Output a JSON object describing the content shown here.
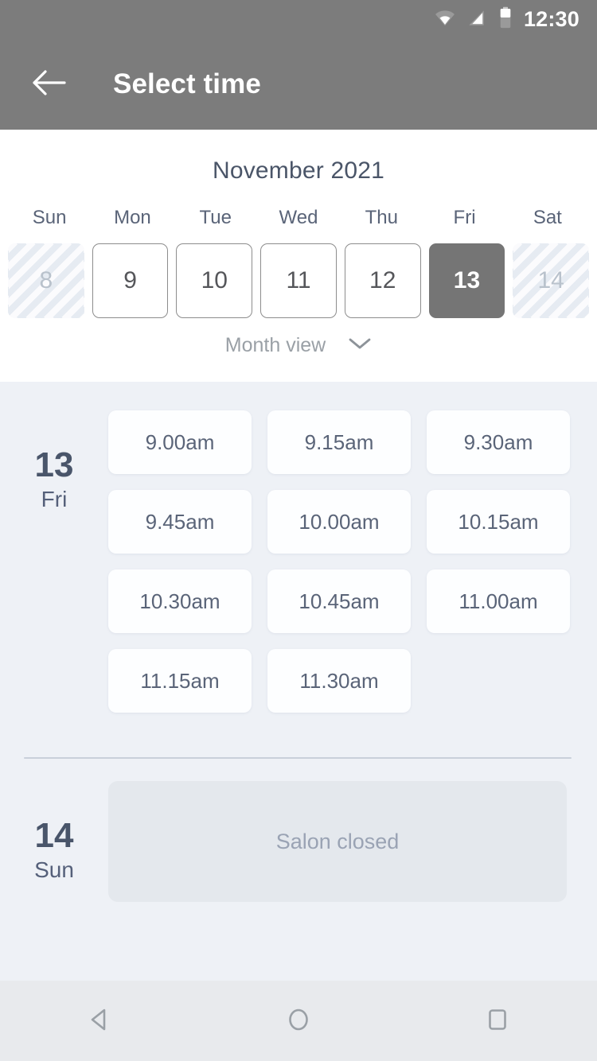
{
  "status_bar": {
    "time": "12:30",
    "icons": [
      "wifi-icon",
      "cellular-signal-icon",
      "battery-icon"
    ]
  },
  "app_bar": {
    "back_icon": "arrow-left-icon",
    "title": "Select time"
  },
  "calendar": {
    "month_title": "November 2021",
    "weekdays": [
      "Sun",
      "Mon",
      "Tue",
      "Wed",
      "Thu",
      "Fri",
      "Sat"
    ],
    "dates": [
      {
        "day": "8",
        "state": "disabled"
      },
      {
        "day": "9",
        "state": "enabled"
      },
      {
        "day": "10",
        "state": "enabled"
      },
      {
        "day": "11",
        "state": "enabled"
      },
      {
        "day": "12",
        "state": "enabled"
      },
      {
        "day": "13",
        "state": "selected"
      },
      {
        "day": "14",
        "state": "disabled"
      }
    ],
    "view_toggle": {
      "label": "Month view",
      "icon": "chevron-down-icon"
    }
  },
  "schedule": {
    "days": [
      {
        "day_number": "13",
        "day_of_week": "Fri",
        "slots": [
          "9.00am",
          "9.15am",
          "9.30am",
          "9.45am",
          "10.00am",
          "10.15am",
          "10.30am",
          "10.45am",
          "11.00am",
          "11.15am",
          "11.30am"
        ]
      },
      {
        "day_number": "14",
        "day_of_week": "Sun",
        "closed_message": "Salon closed"
      }
    ]
  },
  "nav_bar": {
    "buttons": [
      {
        "name": "back-nav-icon",
        "shape": "triangle-left"
      },
      {
        "name": "home-nav-icon",
        "shape": "circle"
      },
      {
        "name": "recents-nav-icon",
        "shape": "square"
      }
    ]
  },
  "colors": {
    "app_bar": "#7c7c7c",
    "selected_date": "#757575",
    "slots_background": "#eef1f6",
    "text_slate": "#4a5568",
    "nav_bar": "#e8eaed"
  }
}
